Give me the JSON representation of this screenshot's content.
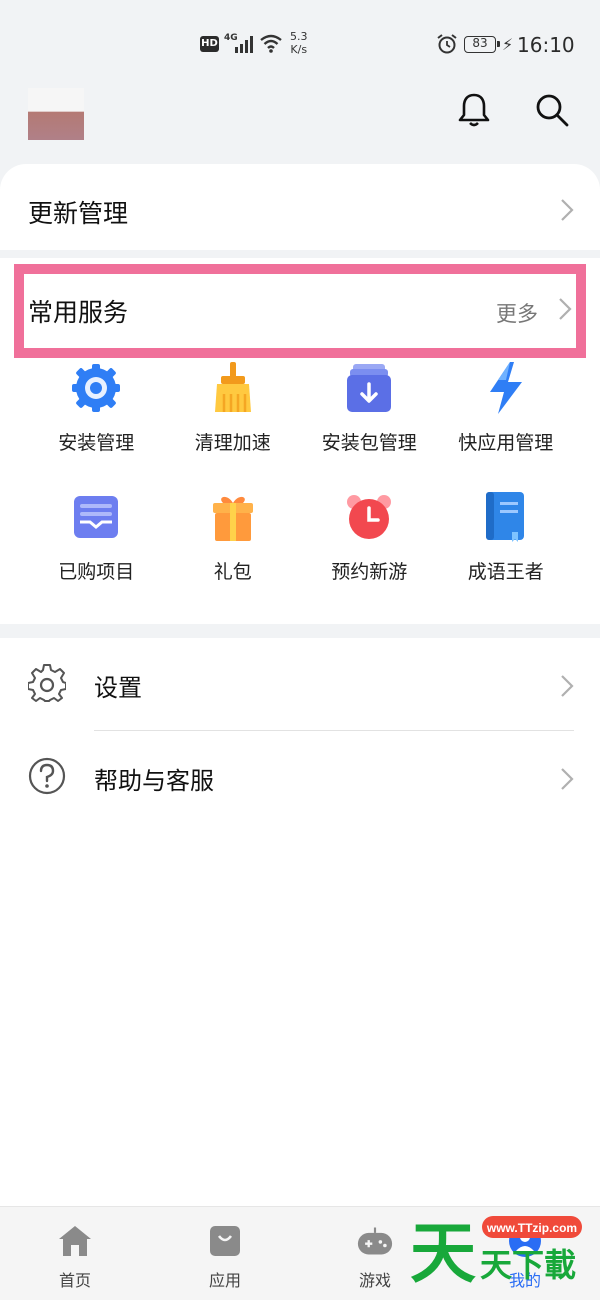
{
  "status_bar": {
    "hd": "HD",
    "network": "4G",
    "speed_value": "5.3",
    "speed_unit": "K/s",
    "battery": "83",
    "time": "16:10"
  },
  "header": {
    "bell_icon": "bell-icon",
    "search_icon": "search-icon"
  },
  "update_card": {
    "title": "更新管理"
  },
  "services": {
    "title": "常用服务",
    "more": "更多",
    "highlight_color": "#f0709a",
    "items": [
      {
        "label": "安装管理",
        "icon": "gear-install-icon"
      },
      {
        "label": "清理加速",
        "icon": "broom-icon"
      },
      {
        "label": "安装包管理",
        "icon": "package-icon"
      },
      {
        "label": "快应用管理",
        "icon": "lightning-icon"
      },
      {
        "label": "已购项目",
        "icon": "purchased-icon"
      },
      {
        "label": "礼包",
        "icon": "gift-icon"
      },
      {
        "label": "预约新游",
        "icon": "alarm-clock-icon"
      },
      {
        "label": "成语王者",
        "icon": "book-icon"
      }
    ]
  },
  "settings": {
    "items": [
      {
        "label": "设置",
        "icon": "gear-icon"
      },
      {
        "label": "帮助与客服",
        "icon": "help-icon"
      }
    ]
  },
  "nav": {
    "items": [
      {
        "label": "首页",
        "icon": "home-icon"
      },
      {
        "label": "应用",
        "icon": "app-bag-icon"
      },
      {
        "label": "游戏",
        "icon": "gamepad-icon"
      },
      {
        "label": "我的",
        "icon": "profile-icon",
        "active": true
      }
    ]
  },
  "watermark": {
    "url": "www.TTzip.com",
    "text": "天天下載"
  },
  "colors": {
    "accent": "#2a6df4",
    "background": "#f1f3f5"
  }
}
